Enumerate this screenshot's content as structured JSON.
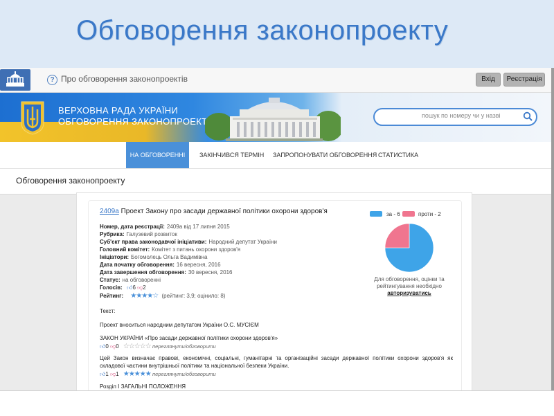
{
  "slide": {
    "title": "Обговорення законопроекту"
  },
  "topbar": {
    "help_icon": "question-icon",
    "link": "Про обговорення законопроектів",
    "login_label": "Вхід",
    "register_label": "Реєстрація"
  },
  "header": {
    "line1": "ВЕРХОВНА РАДА УКРАЇНИ",
    "line2": "ОБГОВОРЕННЯ ЗАКОНОПРОЕКТІВ",
    "search_placeholder": "пошук по номеру чи у назві"
  },
  "nav": {
    "items": [
      {
        "label": "НА ОБГОВОРЕННІ",
        "active": true
      },
      {
        "label": "ЗАКІНЧИВСЯ ТЕРМІН",
        "active": false
      },
      {
        "label": "ЗАПРОПОНУВАТИ ОБГОВОРЕННЯ",
        "active": false
      },
      {
        "label": "СТАТИСТИКА",
        "active": false
      }
    ]
  },
  "page": {
    "title": "Обговорення законопроекту"
  },
  "bill": {
    "number": "2409а",
    "title": " Проект Закону про засади державної політики охорони здоров'я",
    "meta": [
      {
        "label": "Номер, дата реєстрації:",
        "value": "2409а від 17 липня 2015"
      },
      {
        "label": "Рубрика:",
        "value": "Галузевий розвиток"
      },
      {
        "label": "Суб'єкт права законодавчої ініціативи:",
        "value": "Народний депутат України"
      },
      {
        "label": "Головний комітет:",
        "value": "Комітет з питань охорони здоров'я"
      },
      {
        "label": "Ініціатори:",
        "value": "Богомолець Ольга Вадимівна"
      },
      {
        "label": "Дата початку обговорення:",
        "value": "16 вересня, 2016"
      },
      {
        "label": "Дата завершення обговорення:",
        "value": "30 вересня, 2016"
      },
      {
        "label": "Статус:",
        "value": "на обговоренні"
      }
    ],
    "votes_label": "Голосів:",
    "votes_for": "6",
    "votes_against": "2",
    "rating_label": "Рейтинг:",
    "rating_text": "(рейтинг: 3,9; оцінило: 8)",
    "rating_value": 3.9
  },
  "chart": {
    "legend_for": "за - 6",
    "legend_against": "проти - 2",
    "color_for": "#3ea4e8",
    "color_against": "#f0758f"
  },
  "chart_data": {
    "type": "pie",
    "categories": [
      "за",
      "проти"
    ],
    "values": [
      6,
      2
    ]
  },
  "auth": {
    "note": "Для обговорення, оцінки та рейтингування необхідно",
    "link": "авторизуватись"
  },
  "text": {
    "heading": "Текст:",
    "intro": "Проект вноситься народним депутатом України О.С. МУСІЄМ",
    "law_title": "ЗАКОН УКРАЇНИ «Про засади державної політики охорони здоров'я»",
    "law_votes_for": "0",
    "law_votes_against": "0",
    "discuss_label": "переглянути/обговорити",
    "para1": "Цей Закон визначає правові, економічні, соціальні, гуманітарні та організаційні засади державної політики охорони здоров'я як складової частини внутрішньої політики та національної безпеки України.",
    "para1_votes_for": "1",
    "para1_votes_against": "1",
    "section": "Розділ I ЗАГАЛЬНІ ПОЛОЖЕННЯ"
  }
}
